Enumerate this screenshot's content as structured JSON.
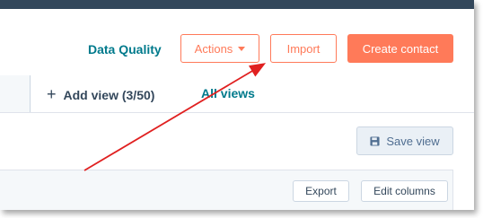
{
  "header": {
    "data_quality_label": "Data Quality",
    "actions_label": "Actions",
    "import_label": "Import",
    "create_contact_label": "Create contact"
  },
  "views": {
    "add_view_label": "Add view (3/50)",
    "all_views_label": "All views",
    "save_view_label": "Save view"
  },
  "table_toolbar": {
    "export_label": "Export",
    "edit_columns_label": "Edit columns"
  },
  "icons": {
    "actions_caret": "caret-down-icon",
    "add_view": "plus-icon",
    "save_view": "floppy-disk-icon"
  },
  "colors": {
    "accent_orange": "#ff7a59",
    "link_teal": "#007a8c",
    "top_bar": "#33475b",
    "annotation_arrow": "#e02020"
  }
}
